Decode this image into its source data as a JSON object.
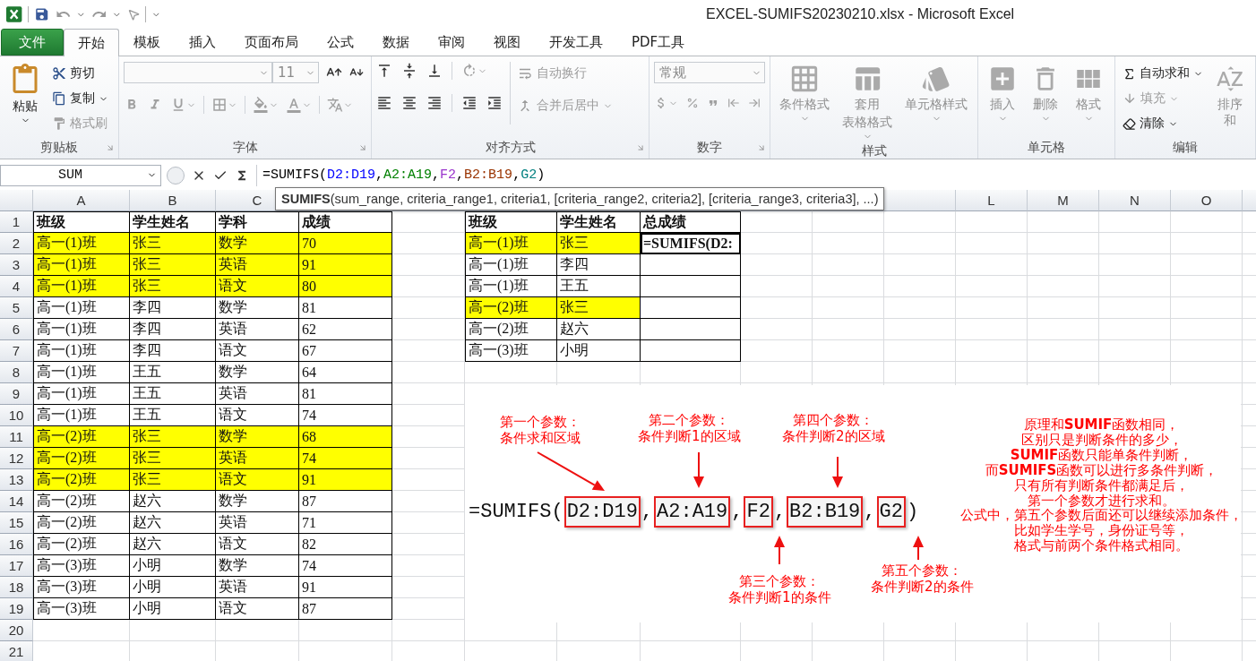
{
  "window": {
    "title": "EXCEL-SUMIFS20230210.xlsx - Microsoft Excel"
  },
  "tabs": [
    {
      "label": "文件",
      "kind": "file",
      "selected": false
    },
    {
      "label": "开始",
      "kind": "tab",
      "selected": true
    },
    {
      "label": "模板",
      "kind": "tab",
      "selected": false
    },
    {
      "label": "插入",
      "kind": "tab",
      "selected": false
    },
    {
      "label": "页面布局",
      "kind": "tab",
      "selected": false
    },
    {
      "label": "公式",
      "kind": "tab",
      "selected": false
    },
    {
      "label": "数据",
      "kind": "tab",
      "selected": false
    },
    {
      "label": "审阅",
      "kind": "tab",
      "selected": false
    },
    {
      "label": "视图",
      "kind": "tab",
      "selected": false
    },
    {
      "label": "开发工具",
      "kind": "tab",
      "selected": false
    },
    {
      "label": "PDF工具",
      "kind": "tab",
      "selected": false
    }
  ],
  "ribbon": {
    "groups": [
      {
        "label": "剪贴板",
        "items": [
          {
            "label": "粘贴",
            "disabled": false
          },
          {
            "label": "剪切",
            "disabled": false
          },
          {
            "label": "复制",
            "disabled": false
          },
          {
            "label": "格式刷",
            "disabled": true
          }
        ]
      },
      {
        "label": "字体",
        "font_size": "11"
      },
      {
        "label": "对齐方式",
        "items": [
          {
            "label": "自动换行",
            "disabled": true
          },
          {
            "label": "合并后居中",
            "disabled": true
          }
        ]
      },
      {
        "label": "数字",
        "number_format": "常规"
      },
      {
        "label": "样式",
        "items": [
          {
            "label": "条件格式",
            "disabled": true
          },
          {
            "lines": [
              "套用",
              "表格格式"
            ],
            "disabled": true
          },
          {
            "label": "单元格样式",
            "disabled": true
          }
        ]
      },
      {
        "label": "单元格",
        "items": [
          {
            "label": "插入",
            "disabled": true
          },
          {
            "label": "删除",
            "disabled": true
          },
          {
            "label": "格式",
            "disabled": true
          }
        ]
      },
      {
        "label": "编辑",
        "items": [
          {
            "label": "自动求和",
            "disabled": false
          },
          {
            "label": "填充",
            "disabled": true
          },
          {
            "label": "清除",
            "disabled": false
          },
          {
            "label": "排序和",
            "disabled": true
          }
        ]
      }
    ]
  },
  "formula_bar": {
    "name_box": "SUM",
    "parts": [
      {
        "text": "=SUMIFS("
      },
      {
        "text": "D2:D19",
        "color": "#0000ff"
      },
      {
        "text": ","
      },
      {
        "text": "A2:A19",
        "color": "#008000"
      },
      {
        "text": ","
      },
      {
        "text": "F2",
        "color": "#9933cc"
      },
      {
        "text": ","
      },
      {
        "text": "B2:B19",
        "color": "#993300"
      },
      {
        "text": ","
      },
      {
        "text": "G2",
        "color": "#008080"
      },
      {
        "text": ")"
      }
    ]
  },
  "tooltip": "**SUMIFS**(sum_range, criteria_range1, criteria1, [criteria_range2, criteria2], [criteria_range3, criteria3], ...)",
  "sheet": {
    "column_headers": {
      "left": [
        "A",
        "B",
        "C"
      ],
      "right": [
        "L",
        "M",
        "N",
        "O"
      ]
    },
    "row_numbers": [
      "1",
      "2",
      "3",
      "4",
      "5",
      "6",
      "7",
      "8",
      "9",
      "10",
      "11",
      "12",
      "13",
      "14",
      "15",
      "16",
      "17",
      "18",
      "19",
      "20",
      "21"
    ],
    "left_table": {
      "header": [
        "班级",
        "学生姓名",
        "学科",
        "成绩"
      ],
      "rows": [
        {
          "cells": [
            "高一(1)班",
            "张三",
            "数学",
            "70"
          ],
          "highlighted": true
        },
        {
          "cells": [
            "高一(1)班",
            "张三",
            "英语",
            "91"
          ],
          "highlighted": true
        },
        {
          "cells": [
            "高一(1)班",
            "张三",
            "语文",
            "80"
          ],
          "highlighted": true
        },
        {
          "cells": [
            "高一(1)班",
            "李四",
            "数学",
            "81"
          ],
          "highlighted": false
        },
        {
          "cells": [
            "高一(1)班",
            "李四",
            "英语",
            "62"
          ],
          "highlighted": false
        },
        {
          "cells": [
            "高一(1)班",
            "李四",
            "语文",
            "67"
          ],
          "highlighted": false
        },
        {
          "cells": [
            "高一(1)班",
            "王五",
            "数学",
            "64"
          ],
          "highlighted": false
        },
        {
          "cells": [
            "高一(1)班",
            "王五",
            "英语",
            "81"
          ],
          "highlighted": false
        },
        {
          "cells": [
            "高一(1)班",
            "王五",
            "语文",
            "74"
          ],
          "highlighted": false
        },
        {
          "cells": [
            "高一(2)班",
            "张三",
            "数学",
            "68"
          ],
          "highlighted": true
        },
        {
          "cells": [
            "高一(2)班",
            "张三",
            "英语",
            "74"
          ],
          "highlighted": true
        },
        {
          "cells": [
            "高一(2)班",
            "张三",
            "语文",
            "91"
          ],
          "highlighted": true
        },
        {
          "cells": [
            "高一(2)班",
            "赵六",
            "数学",
            "87"
          ],
          "highlighted": false
        },
        {
          "cells": [
            "高一(2)班",
            "赵六",
            "英语",
            "71"
          ],
          "highlighted": false
        },
        {
          "cells": [
            "高一(2)班",
            "赵六",
            "语文",
            "82"
          ],
          "highlighted": false
        },
        {
          "cells": [
            "高一(3)班",
            "小明",
            "数学",
            "74"
          ],
          "highlighted": false
        },
        {
          "cells": [
            "高一(3)班",
            "小明",
            "英语",
            "91"
          ],
          "highlighted": false
        },
        {
          "cells": [
            "高一(3)班",
            "小明",
            "语文",
            "87"
          ],
          "highlighted": false
        }
      ]
    },
    "right_table": {
      "header": [
        "班级",
        "学生姓名",
        "总成绩"
      ],
      "rows": [
        {
          "cells": [
            "高一(1)班",
            "张三"
          ],
          "highlighted": true,
          "total": "=SUMIFS(D2:",
          "editing": true
        },
        {
          "cells": [
            "高一(1)班",
            "李四"
          ],
          "highlighted": false,
          "editing": false
        },
        {
          "cells": [
            "高一(1)班",
            "王五"
          ],
          "highlighted": false,
          "editing": false
        },
        {
          "cells": [
            "高一(2)班",
            "张三"
          ],
          "highlighted": true,
          "editing": false
        },
        {
          "cells": [
            "高一(2)班",
            "赵六"
          ],
          "highlighted": false,
          "editing": false
        },
        {
          "cells": [
            "高一(3)班",
            "小明"
          ],
          "highlighted": false,
          "editing": false
        }
      ]
    }
  },
  "annotations": {
    "formula": [
      {
        "text": "=SUMIFS(",
        "boxed": false
      },
      {
        "text": "D2:D19",
        "boxed": true
      },
      {
        "text": ",",
        "boxed": false
      },
      {
        "text": "A2:A19",
        "boxed": true
      },
      {
        "text": ",",
        "boxed": false
      },
      {
        "text": "F2",
        "boxed": true
      },
      {
        "text": ",",
        "boxed": false
      },
      {
        "text": "B2:B19",
        "boxed": true
      },
      {
        "text": ",",
        "boxed": false
      },
      {
        "text": "G2",
        "boxed": true
      },
      {
        "text": ")",
        "boxed": false
      }
    ],
    "labels": [
      {
        "lines": [
          "第一个参数：",
          "条件求和区域"
        ]
      },
      {
        "lines": [
          "第二个参数：",
          "条件判断1的区域"
        ]
      },
      {
        "lines": [
          "第四个参数：",
          "条件判断2的区域"
        ]
      },
      {
        "lines": [
          "第三个参数：",
          "条件判断1的条件"
        ]
      },
      {
        "lines": [
          "第五个参数：",
          "条件判断2的条件"
        ]
      }
    ],
    "note": [
      "原理和**SUMIF**函数相同，",
      "区别只是判断条件的多少，",
      "**SUMIF**函数只能单条件判断，",
      "而**SUMIFS**函数可以进行多条件判断，",
      "只有所有判断条件都满足后，",
      "第一个参数才进行求和。",
      "公式中，第五个参数后面还可以继续添加条件，",
      "比如学生学号，身份证号等，",
      "格式与前两个条件格式相同。"
    ]
  }
}
